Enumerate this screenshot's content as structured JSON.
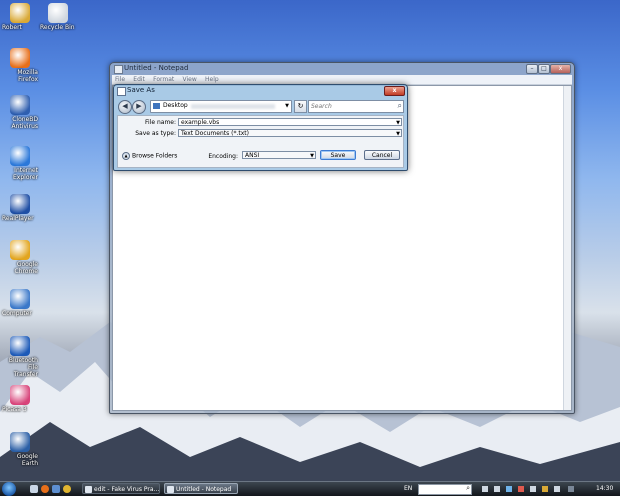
{
  "desktop": {
    "icons": [
      {
        "label": "Robert",
        "icon": "user-folder-icon",
        "color": "#d9a936"
      },
      {
        "label": "Recycle Bin",
        "icon": "recycle-bin-icon",
        "color": "#cfd6de"
      },
      {
        "label": "Mozilla Firefox",
        "icon": "firefox-icon",
        "color": "#e76f1a"
      },
      {
        "label": "CloneBD Antivirus",
        "icon": "shield-icon",
        "color": "#2f5fb0"
      },
      {
        "label": "Internet Explorer",
        "icon": "internet-explorer-icon",
        "color": "#2b78d9"
      },
      {
        "label": "RealPlayer",
        "icon": "realplayer-icon",
        "color": "#1f4fa5"
      },
      {
        "label": "Google Chrome",
        "icon": "chrome-icon",
        "color": "#e2a51e"
      },
      {
        "label": "Computer",
        "icon": "computer-icon",
        "color": "#3a78c9"
      },
      {
        "label": "Bluetooth File Transfer",
        "icon": "bluetooth-icon",
        "color": "#1d5ab8"
      },
      {
        "label": "Picasa 3",
        "icon": "picasa-icon",
        "color": "#d8447a"
      },
      {
        "label": "Google Earth",
        "icon": "google-earth-icon",
        "color": "#2b5fa6"
      }
    ]
  },
  "notepad": {
    "title": "Untitled - Notepad",
    "menu": [
      "File",
      "Edit",
      "Format",
      "View",
      "Help"
    ],
    "caption_buttons": {
      "minimize": "–",
      "maximize": "□",
      "close": "x"
    }
  },
  "save_dialog": {
    "title": "Save As",
    "close_label": "x",
    "location": "Desktop",
    "search_placeholder": "Search",
    "file_name_label": "File name:",
    "file_name_value": "example.vbs",
    "save_as_type_label": "Save as type:",
    "save_as_type_value": "Text Documents (*.txt)",
    "browse_folders_label": "Browse Folders",
    "encoding_label": "Encoding:",
    "encoding_value": "ANSI",
    "save_button": "Save",
    "cancel_button": "Cancel"
  },
  "taskbar": {
    "tasks": [
      {
        "label": "edit - Fake Virus Pra..."
      },
      {
        "label": "Untitled - Notepad"
      }
    ],
    "language": "EN",
    "clock": "14:30"
  }
}
